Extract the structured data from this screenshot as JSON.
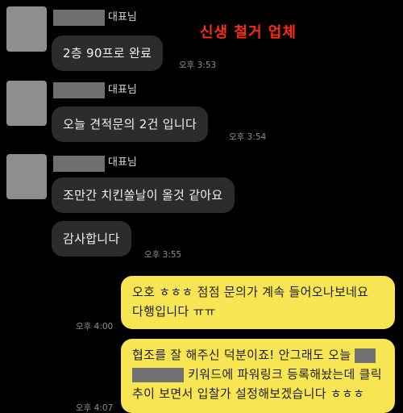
{
  "overlay_title": "신생 철거 업체",
  "sender_role": "대표님",
  "messages_in": [
    {
      "text": "2층 90프로 완료",
      "time": "오후 3:53"
    },
    {
      "text": "오늘 견적문의 2건  입니다",
      "time": "오후 3:54"
    },
    {
      "text": "조만간 치킨쏠날이  올것 같아요"
    },
    {
      "text": "감사합니다",
      "time": "오후 3:55"
    }
  ],
  "messages_out": [
    {
      "line1": "오호 ㅎㅎㅎ 점점 문의가 계속 들어오나보네요",
      "line2": "다행입니다 ㅠㅠ",
      "time": "오후 4:00"
    },
    {
      "line1_a": "협조를 잘 해주신 덕분이죠! 안그래도 오늘",
      "line2_b": "키워드에 파워링크 등록해놨는데 클릭",
      "line3": "추이 보면서 입찰가 설정해보겠습니다 ㅎㅎㅎ",
      "time": "오후 4:07"
    }
  ]
}
